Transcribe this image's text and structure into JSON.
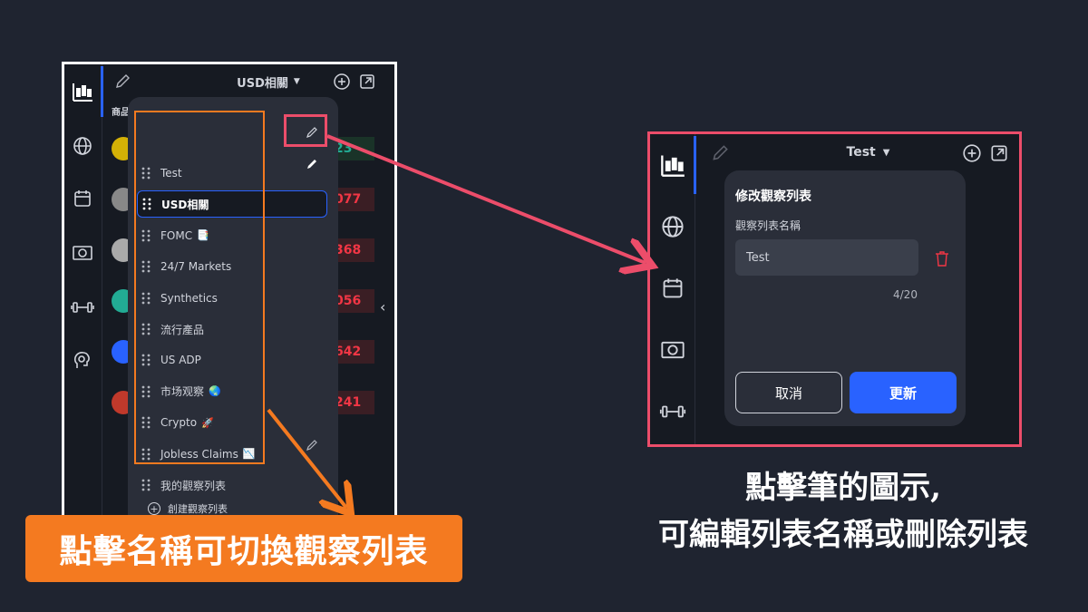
{
  "left_panel": {
    "header_title": "USD相關",
    "sub_label": "商品",
    "background_values": [
      "23",
      "077",
      "368",
      "056",
      "642",
      "241"
    ],
    "dropdown": {
      "items": [
        {
          "label": "Test",
          "emoji": ""
        },
        {
          "label": "USD相關",
          "emoji": ""
        },
        {
          "label": "FOMC",
          "emoji": "📑"
        },
        {
          "label": "24/7 Markets",
          "emoji": ""
        },
        {
          "label": "Synthetics",
          "emoji": ""
        },
        {
          "label": "流行產品",
          "emoji": ""
        },
        {
          "label": "US ADP",
          "emoji": ""
        },
        {
          "label": "市场观察",
          "emoji": "🌏"
        },
        {
          "label": "Crypto",
          "emoji": "🚀"
        },
        {
          "label": "Jobless Claims",
          "emoji": "📉"
        },
        {
          "label": "我的觀察列表",
          "emoji": ""
        }
      ],
      "selected_index": 1,
      "create_label": "創建觀察列表"
    },
    "icons": [
      "candles-icon",
      "globe-icon",
      "calendar-icon",
      "banknote-icon",
      "dumbbell-icon",
      "brain-icon"
    ]
  },
  "caption_left": "點擊名稱可切換觀察列表",
  "right_panel": {
    "header_title": "Test",
    "modal": {
      "title": "修改觀察列表",
      "field_label": "觀察列表名稱",
      "field_value": "Test",
      "counter": "4/20",
      "cancel_label": "取消",
      "update_label": "更新"
    }
  },
  "caption_right_line1": "點擊筆的圖示,",
  "caption_right_line2": "可編輯列表名稱或刪除列表",
  "colors": {
    "background": "#1f2430",
    "accent_blue": "#2962ff",
    "highlight_orange": "#f47a20",
    "highlight_pink": "#ec4d6a"
  }
}
